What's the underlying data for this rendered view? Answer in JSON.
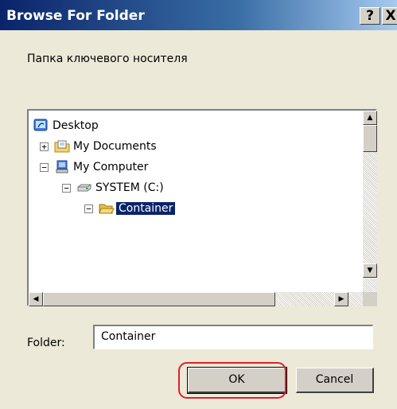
{
  "window": {
    "title": "Browse For Folder",
    "help_label": "?",
    "close_label": "X"
  },
  "prompt": "Папка ключевого носителя",
  "tree": {
    "items": [
      {
        "label": "Desktop",
        "icon": "desktop-icon",
        "expander": ""
      },
      {
        "label": "My Documents",
        "icon": "my-documents-folder-icon",
        "expander": "+"
      },
      {
        "label": "My Computer",
        "icon": "my-computer-icon",
        "expander": "−"
      },
      {
        "label": "SYSTEM (C:)",
        "icon": "drive-icon",
        "expander": "−"
      },
      {
        "label": "Container",
        "icon": "open-folder-icon",
        "expander": "−",
        "selected": true
      }
    ]
  },
  "scroll": {
    "up": "▲",
    "down": "▼",
    "left": "◀",
    "right": "▶"
  },
  "folder": {
    "label": "Folder:",
    "value": "Container"
  },
  "buttons": {
    "ok": "OK",
    "cancel": "Cancel"
  },
  "colors": {
    "selection": "#0a246a",
    "highlight_ring": "#e0202a",
    "dialog_bg": "#ece9d8"
  }
}
